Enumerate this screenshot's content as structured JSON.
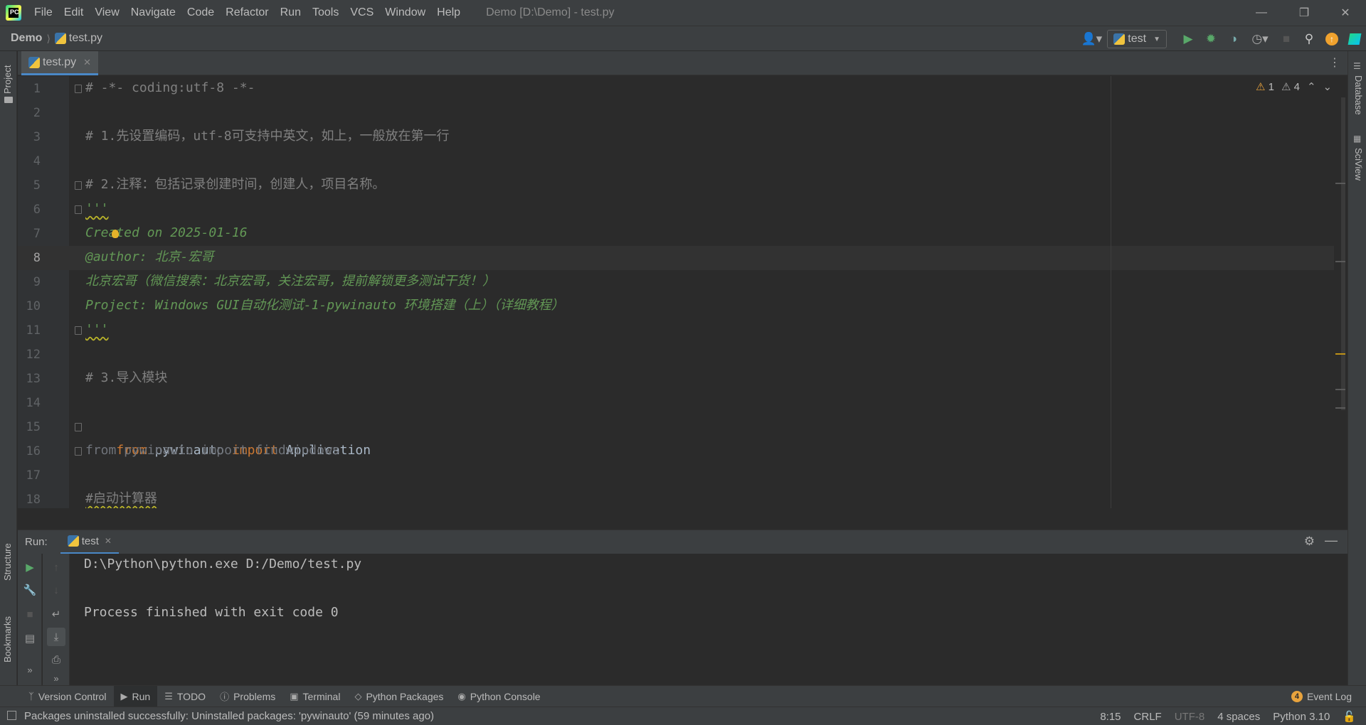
{
  "window": {
    "title": "Demo [D:\\Demo] - test.py",
    "menu": [
      "File",
      "Edit",
      "View",
      "Navigate",
      "Code",
      "Refactor",
      "Run",
      "Tools",
      "VCS",
      "Window",
      "Help"
    ]
  },
  "navbar": {
    "project": "Demo",
    "file": "test.py",
    "run_config": "test"
  },
  "left_strip": {
    "project": "Project",
    "structure": "Structure",
    "bookmarks": "Bookmarks"
  },
  "right_strip": {
    "database": "Database",
    "sciview": "SciView"
  },
  "editor": {
    "tab": "test.py",
    "inspections": {
      "errors": "1",
      "warnings": "4"
    },
    "current_line": 8,
    "lines": [
      {
        "no": "1",
        "text": "# -*- coding:utf-8 -*-",
        "style": "comment"
      },
      {
        "no": "2",
        "text": "",
        "style": "comment"
      },
      {
        "no": "3",
        "text": "# 1.先设置编码，utf-8可支持中英文，如上，一般放在第一行",
        "style": "comment"
      },
      {
        "no": "4",
        "text": "",
        "style": "comment"
      },
      {
        "no": "5",
        "text": "# 2.注释：包括记录创建时间，创建人，项目名称。",
        "style": "comment"
      },
      {
        "no": "6",
        "text": "'''",
        "style": "doc"
      },
      {
        "no": "7",
        "text": "Created on 2025-01-16",
        "style": "doc"
      },
      {
        "no": "8",
        "text": "@author: 北京-宏哥",
        "style": "doc"
      },
      {
        "no": "9",
        "text": "北京宏哥（微信搜索：北京宏哥，关注宏哥，提前解锁更多测试干货！）",
        "style": "doc"
      },
      {
        "no": "10",
        "text": "Project: Windows GUI自动化测试-1-pywinauto 环境搭建（上）（详细教程）",
        "style": "doc"
      },
      {
        "no": "11",
        "text": "'''",
        "style": "doc"
      },
      {
        "no": "12",
        "text": "",
        "style": "comment"
      },
      {
        "no": "13",
        "text": "# 3.导入模块",
        "style": "comment"
      },
      {
        "no": "14",
        "text": "",
        "style": "comment"
      },
      {
        "no": "15",
        "text": "",
        "style": "code"
      },
      {
        "no": "16",
        "text": "from pywinauto import findwindows",
        "style": "unused"
      },
      {
        "no": "17",
        "text": "",
        "style": "comment"
      },
      {
        "no": "18",
        "text": "#启动计算器",
        "style": "comment"
      }
    ],
    "line15": {
      "kw1": "from",
      "mod": "pywinauto",
      "kw2": "import",
      "name": "Application"
    }
  },
  "run_panel": {
    "label": "Run:",
    "tab": "test",
    "console": [
      "D:\\Python\\python.exe D:/Demo/test.py",
      "",
      "Process finished with exit code 0"
    ]
  },
  "tool_windows": {
    "version_control": "Version Control",
    "run": "Run",
    "todo": "TODO",
    "problems": "Problems",
    "terminal": "Terminal",
    "python_packages": "Python Packages",
    "python_console": "Python Console",
    "event_log": "Event Log",
    "event_count": "4"
  },
  "status_bar": {
    "message": "Packages uninstalled successfully: Uninstalled packages: 'pywinauto' (59 minutes ago)",
    "position": "8:15",
    "line_sep": "CRLF",
    "encoding": "UTF-8",
    "indent": "4 spaces",
    "interpreter": "Python 3.10"
  },
  "colors": {
    "accent": "#4a88c7",
    "keyword": "#cc7832",
    "docstring": "#629755",
    "comment": "#808080",
    "warning": "#e8a33d"
  }
}
